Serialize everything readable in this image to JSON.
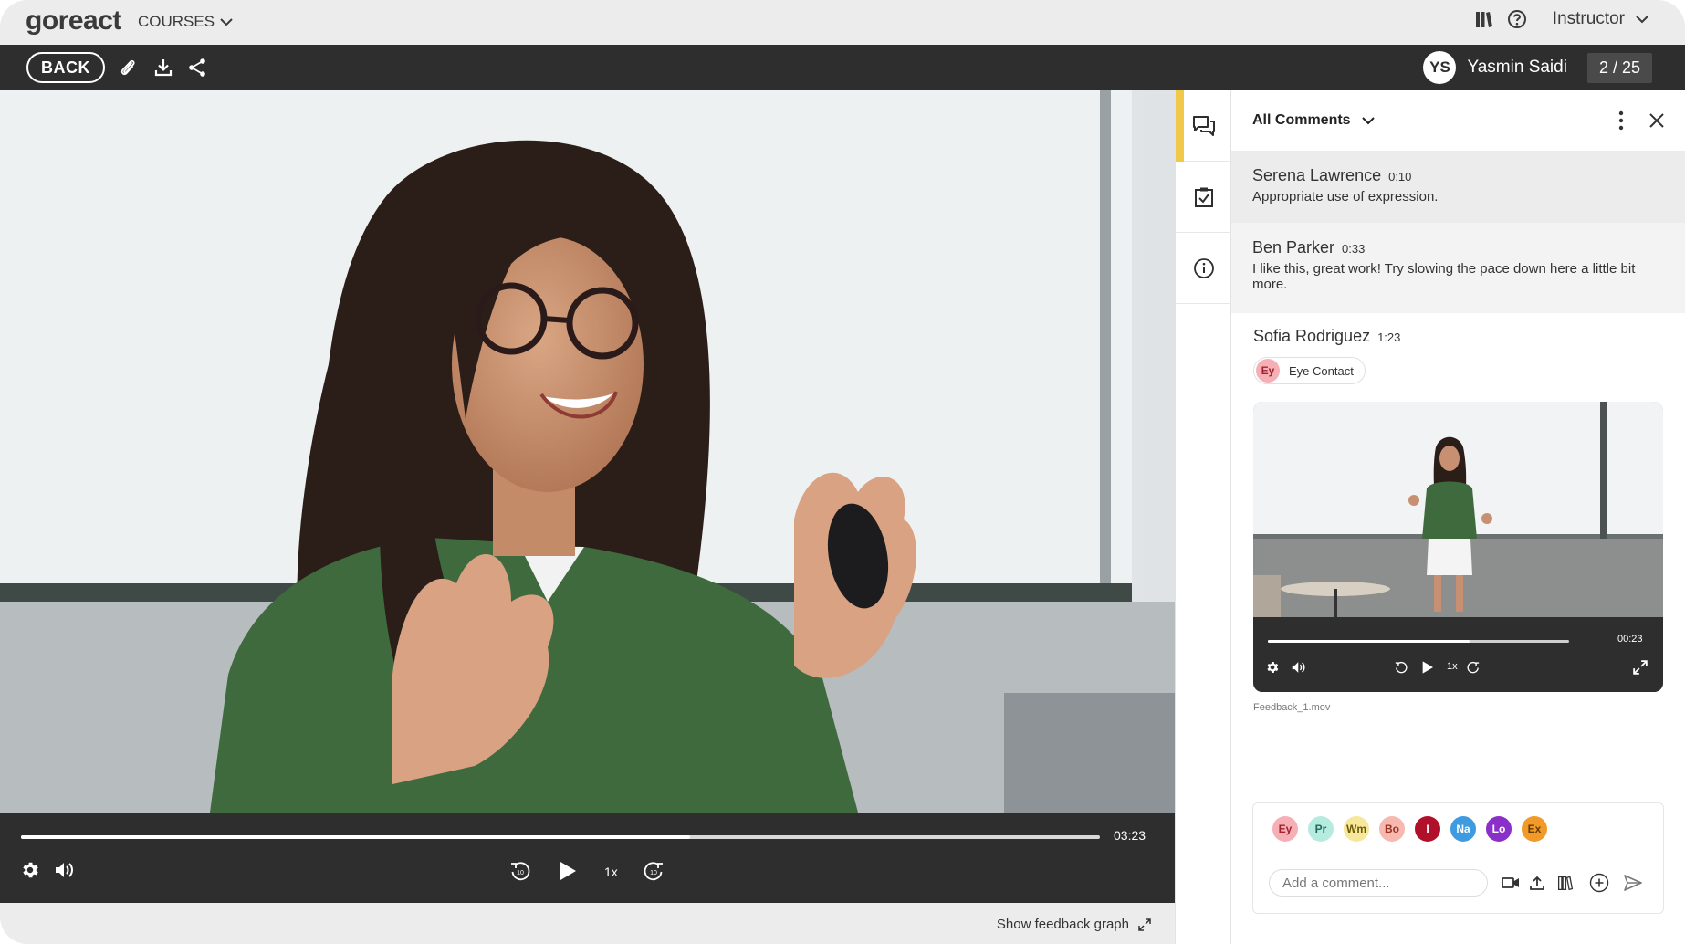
{
  "app": {
    "logo": "goreact",
    "courses_label": "COURSES",
    "role_label": "Instructor"
  },
  "toolbar": {
    "back_label": "BACK",
    "user_initials": "YS",
    "user_name": "Yasmin Saidi",
    "counter": "2 / 25"
  },
  "player": {
    "time": "03:23",
    "speed": "1x",
    "progress": 0.62
  },
  "bottom": {
    "feedback_graph_label": "Show feedback graph"
  },
  "panel": {
    "filter_label": "All Comments",
    "comments": [
      {
        "name": "Serena Lawrence",
        "time": "0:10",
        "text": "Appropriate use of expression."
      },
      {
        "name": "Ben Parker",
        "time": "0:33",
        "text": "I like this, great work! Try slowing the pace down here a little bit more."
      },
      {
        "name": "Sofia Rodriguez",
        "time": "1:23",
        "tag_badge": "Ey",
        "tag_label": "Eye Contact"
      }
    ],
    "mini_player": {
      "time": "00:23",
      "speed": "1x",
      "progress": 0.67,
      "file_name": "Feedback_1.mov"
    },
    "compose": {
      "placeholder": "Add a comment...",
      "chips": [
        {
          "label": "Ey",
          "bg": "#f6b0b5",
          "fg": "#a12233"
        },
        {
          "label": "Pr",
          "bg": "#b6ecdf",
          "fg": "#1d6b58"
        },
        {
          "label": "Wm",
          "bg": "#f7e79a",
          "fg": "#6e5a05"
        },
        {
          "label": "Bo",
          "bg": "#f7b8b0",
          "fg": "#9a3324"
        },
        {
          "label": "I",
          "bg": "#b0102a",
          "fg": "#ffffff"
        },
        {
          "label": "Na",
          "bg": "#3f9be0",
          "fg": "#ffffff"
        },
        {
          "label": "Lo",
          "bg": "#8b2fc9",
          "fg": "#ffffff"
        },
        {
          "label": "Ex",
          "bg": "#f09a2a",
          "fg": "#6b3a00"
        }
      ]
    }
  },
  "colors": {
    "dark_bar": "#2e2e2e",
    "light_bar": "#ececec",
    "rail_accent": "#f2c84b"
  }
}
